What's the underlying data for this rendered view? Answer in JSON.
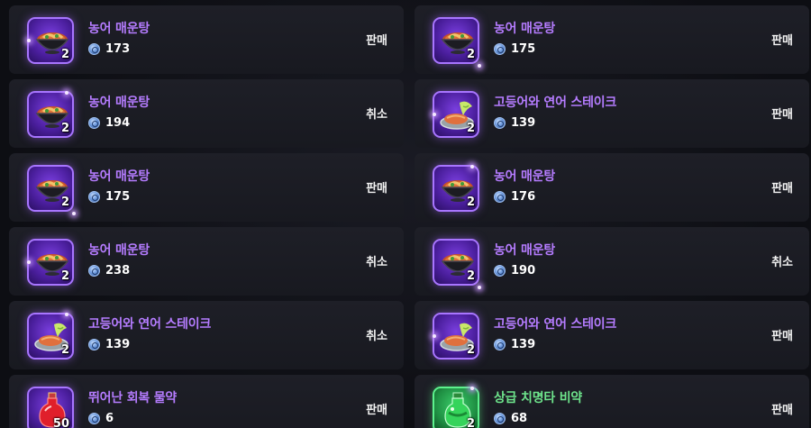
{
  "listings": [
    {
      "name": "농어 매운탕",
      "qty": "2",
      "price": "173",
      "action": "판매",
      "icon": "fish-stew-bowl-icon",
      "rarity": "epic",
      "name_color": "#b57cff"
    },
    {
      "name": "농어 매운탕",
      "qty": "2",
      "price": "175",
      "action": "판매",
      "icon": "fish-stew-bowl-icon",
      "rarity": "epic",
      "name_color": "#b57cff"
    },
    {
      "name": "농어 매운탕",
      "qty": "2",
      "price": "194",
      "action": "취소",
      "icon": "fish-stew-bowl-icon",
      "rarity": "epic",
      "name_color": "#b57cff"
    },
    {
      "name": "고등어와 연어 스테이크",
      "qty": "2",
      "price": "139",
      "action": "판매",
      "icon": "fish-steak-plate-icon",
      "rarity": "epic",
      "name_color": "#b57cff"
    },
    {
      "name": "농어 매운탕",
      "qty": "2",
      "price": "175",
      "action": "판매",
      "icon": "fish-stew-bowl-icon",
      "rarity": "epic",
      "name_color": "#b57cff"
    },
    {
      "name": "농어 매운탕",
      "qty": "2",
      "price": "176",
      "action": "판매",
      "icon": "fish-stew-bowl-icon",
      "rarity": "epic",
      "name_color": "#b57cff"
    },
    {
      "name": "농어 매운탕",
      "qty": "2",
      "price": "238",
      "action": "취소",
      "icon": "fish-stew-bowl-icon",
      "rarity": "epic",
      "name_color": "#b57cff"
    },
    {
      "name": "농어 매운탕",
      "qty": "2",
      "price": "190",
      "action": "취소",
      "icon": "fish-stew-bowl-icon",
      "rarity": "epic",
      "name_color": "#b57cff"
    },
    {
      "name": "고등어와 연어 스테이크",
      "qty": "2",
      "price": "139",
      "action": "취소",
      "icon": "fish-steak-plate-icon",
      "rarity": "epic",
      "name_color": "#b57cff"
    },
    {
      "name": "고등어와 연어 스테이크",
      "qty": "2",
      "price": "139",
      "action": "판매",
      "icon": "fish-steak-plate-icon",
      "rarity": "epic",
      "name_color": "#b57cff"
    },
    {
      "name": "뛰어난 회복 물약",
      "qty": "50",
      "price": "6",
      "action": "판매",
      "icon": "red-potion-icon",
      "rarity": "epic",
      "name_color": "#b57cff"
    },
    {
      "name": "상급 치명타 비약",
      "qty": "2",
      "price": "68",
      "action": "판매",
      "icon": "green-elixir-icon",
      "rarity": "uncommon",
      "name_color": "#6ee58c"
    }
  ],
  "currency_icon": "silver-coin-icon"
}
